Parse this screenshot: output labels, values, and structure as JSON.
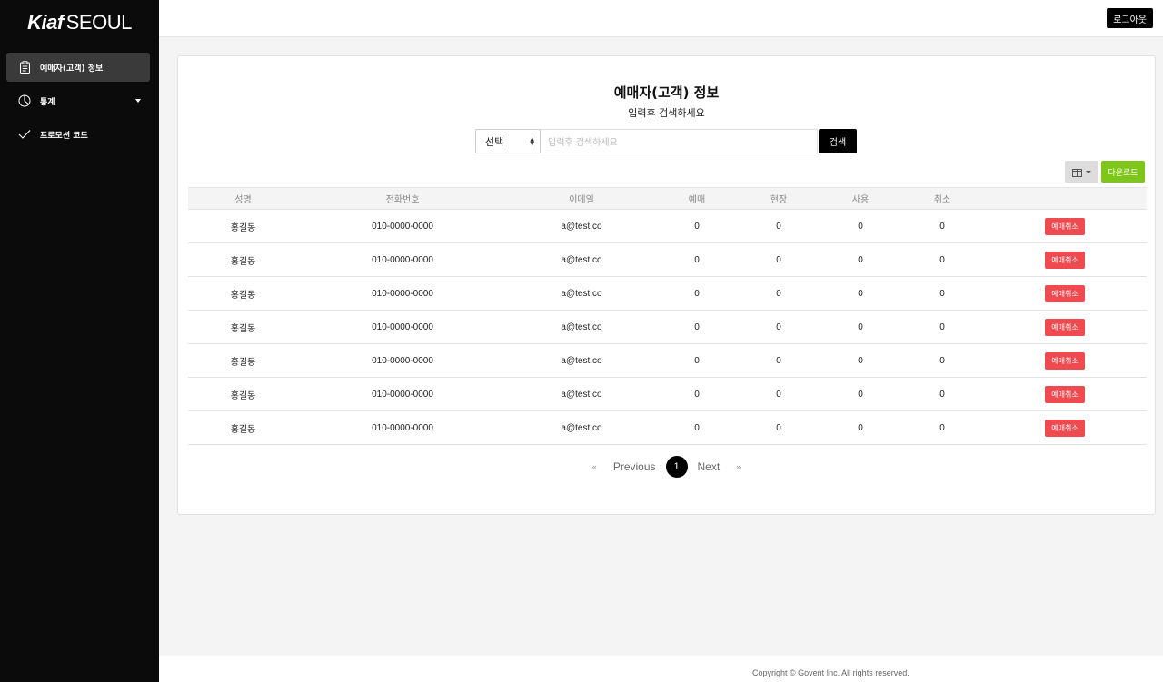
{
  "brand": {
    "bold": "Kiaf",
    "light": "SEOUL"
  },
  "sidebar": {
    "items": [
      {
        "label": "예매자(고객) 정보",
        "icon": "clipboard-icon",
        "active": true
      },
      {
        "label": "통계",
        "icon": "pie-chart-icon",
        "has_caret": true
      },
      {
        "label": "프로모션 코드",
        "icon": "checkmark-icon"
      }
    ]
  },
  "topbar": {
    "logout_label": "로그아웃"
  },
  "page": {
    "title": "예매자(고객) 정보",
    "subtitle": "입력후 검색하세요"
  },
  "search": {
    "select_value": "선택",
    "placeholder": "입력후 검색하세요",
    "button_label": "검색"
  },
  "tools": {
    "columns_icon": "columns-icon",
    "download_label": "다운로드"
  },
  "table": {
    "headers": [
      "성명",
      "전화번호",
      "이메일",
      "예매",
      "현장",
      "사용",
      "취소",
      ""
    ],
    "action_label": "예매취소",
    "rows": [
      [
        "홍길동",
        "010-0000-0000",
        "a@test.co",
        "0",
        "0",
        "0",
        "0"
      ],
      [
        "홍길동",
        "010-0000-0000",
        "a@test.co",
        "0",
        "0",
        "0",
        "0"
      ],
      [
        "홍길동",
        "010-0000-0000",
        "a@test.co",
        "0",
        "0",
        "0",
        "0"
      ],
      [
        "홍길동",
        "010-0000-0000",
        "a@test.co",
        "0",
        "0",
        "0",
        "0"
      ],
      [
        "홍길동",
        "010-0000-0000",
        "a@test.co",
        "0",
        "0",
        "0",
        "0"
      ],
      [
        "홍길동",
        "010-0000-0000",
        "a@test.co",
        "0",
        "0",
        "0",
        "0"
      ],
      [
        "홍길동",
        "010-0000-0000",
        "a@test.co",
        "0",
        "0",
        "0",
        "0"
      ]
    ]
  },
  "pagination": {
    "first": "«",
    "previous": "Previous",
    "current": "1",
    "next": "Next",
    "last": "»"
  },
  "footer": {
    "copyright": "Copyright © Govent Inc. All rights reserved."
  },
  "colors": {
    "sidebar_bg": "#0b0b0b",
    "danger": "#ef4a50",
    "download": "#7ec71a",
    "primary": "#000000"
  }
}
